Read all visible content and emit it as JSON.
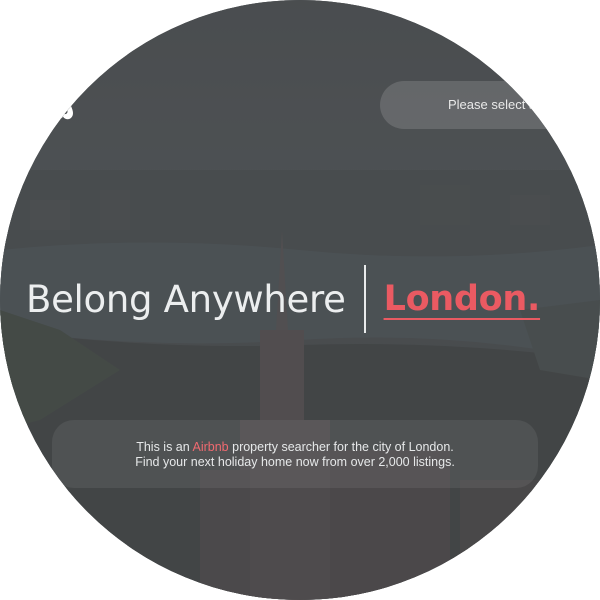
{
  "header": {
    "logo_icon": "airbnb-belo-icon",
    "city_select_placeholder": "Please select a"
  },
  "hero": {
    "tagline": "Belong Anywhere",
    "city": "London."
  },
  "info": {
    "line1_prefix": "This is an ",
    "line1_brand": "Airbnb",
    "line1_suffix": " property searcher for the city of London.",
    "line2": "Find your next holiday home now from over 2,000 listings."
  },
  "colors": {
    "accent": "#ea5a62",
    "text": "#eceeef",
    "background": "#4d5154"
  }
}
